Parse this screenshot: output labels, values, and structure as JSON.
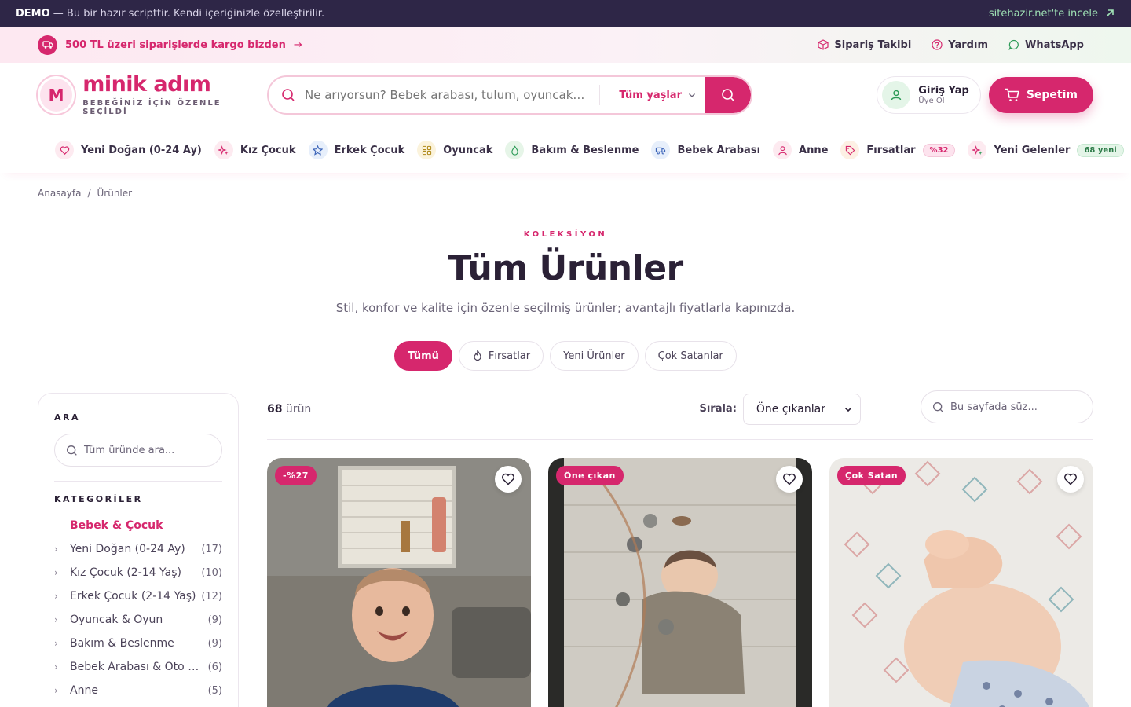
{
  "demo": {
    "strong": "DEMO",
    "text": " — Bu bir hazır scripttir. Kendi içeriğinizle özelleştirilir.",
    "link": "sitehazir.net'te incele"
  },
  "promo": {
    "text": "500 TL üzeri siparişlerde kargo bizden",
    "arrow": "→",
    "links": [
      "Sipariş Takibi",
      "Yardım",
      "WhatsApp"
    ]
  },
  "brand": {
    "initial": "M",
    "name": "minik adım",
    "tagline": "BEBEĞİNİZ İÇİN ÖZENLE SEÇİLDİ",
    "accent": "#d6276d"
  },
  "search": {
    "placeholder": "Ne arıyorsun? Bebek arabası, tulum, oyuncak…",
    "age_select": "Tüm yaşlar"
  },
  "account": {
    "login": "Giriş Yap",
    "register": "Üye Ol",
    "cart": "Sepetim"
  },
  "nav": [
    {
      "label": "Yeni Doğan (0-24 Ay)",
      "icon": "heart-icon"
    },
    {
      "label": "Kız Çocuk",
      "icon": "sparkle-icon"
    },
    {
      "label": "Erkek Çocuk",
      "icon": "star-icon"
    },
    {
      "label": "Oyuncak",
      "icon": "grid-icon"
    },
    {
      "label": "Bakım & Beslenme",
      "icon": "drop-icon"
    },
    {
      "label": "Bebek Arabası",
      "icon": "stroller-icon"
    },
    {
      "label": "Anne",
      "icon": "user-icon"
    },
    {
      "label": "Fırsatlar",
      "icon": "tag-icon",
      "badge": "%32"
    },
    {
      "label": "Yeni Gelenler",
      "icon": "sparkle-icon",
      "badge": "68 yeni"
    }
  ],
  "breadcrumb": {
    "home": "Anasayfa",
    "sep": "/",
    "current": "Ürünler"
  },
  "hero": {
    "eyebrow": "KOLEKSİYON",
    "title": "Tüm Ürünler",
    "subtitle": "Stil, konfor ve kalite için özenle seçilmiş ürünler; avantajlı fiyatlarla kapınızda."
  },
  "filters": [
    "Tümü",
    "Fırsatlar",
    "Yeni Ürünler",
    "Çok Satanlar"
  ],
  "sidebar": {
    "search_heading": "ARA",
    "search_placeholder": "Tüm üründe ara...",
    "cat_heading": "KATEGORİLER",
    "active": "Bebek & Çocuk",
    "categories": [
      {
        "name": "Yeni Doğan (0-24 Ay)",
        "count": "(17)"
      },
      {
        "name": "Kız Çocuk (2-14 Yaş)",
        "count": "(10)"
      },
      {
        "name": "Erkek Çocuk (2-14 Yaş)",
        "count": "(12)"
      },
      {
        "name": "Oyuncak & Oyun",
        "count": "(9)"
      },
      {
        "name": "Bakım & Beslenme",
        "count": "(9)"
      },
      {
        "name": "Bebek Arabası & Oto Koltuğu",
        "count": "(6)"
      },
      {
        "name": "Anne",
        "count": "(5)"
      }
    ]
  },
  "toolbar": {
    "count": "68",
    "count_label": " ürün",
    "sort_label": "Sırala:",
    "sort_value": "Öne çıkanlar",
    "page_filter": "Bu sayfada süz..."
  },
  "products": [
    {
      "badge": "-%27"
    },
    {
      "badge": "Öne çıkan"
    },
    {
      "badge": "Çok Satan"
    }
  ]
}
